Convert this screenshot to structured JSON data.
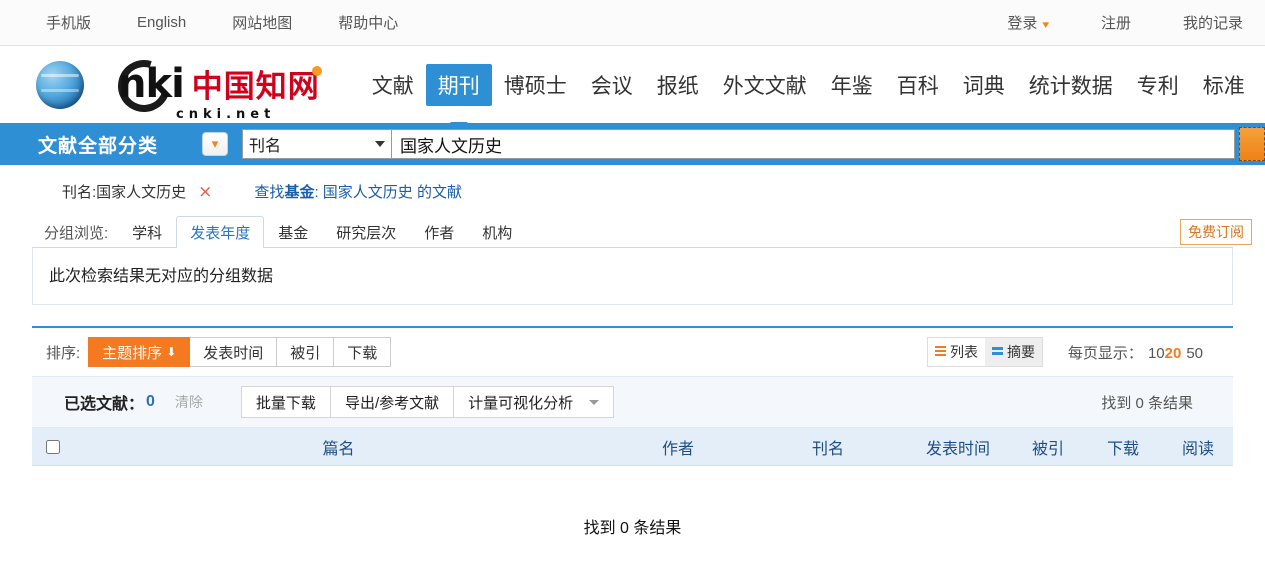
{
  "topbar": {
    "left_links": [
      "手机版",
      "English",
      "网站地图",
      "帮助中心"
    ],
    "login": "登录",
    "register": "注册",
    "my_records": "我的记录"
  },
  "logo": {
    "letters": "nki",
    "chinese": "中国知网",
    "url": "cnki.net"
  },
  "nav": {
    "items": [
      {
        "label": "文献",
        "active": false
      },
      {
        "label": "期刊",
        "active": true
      },
      {
        "label": "博硕士",
        "active": false
      },
      {
        "label": "会议",
        "active": false
      },
      {
        "label": "报纸",
        "active": false
      },
      {
        "label": "外文文献",
        "active": false
      },
      {
        "label": "年鉴",
        "active": false
      },
      {
        "label": "百科",
        "active": false
      },
      {
        "label": "词典",
        "active": false
      },
      {
        "label": "统计数据",
        "active": false
      },
      {
        "label": "专利",
        "active": false
      },
      {
        "label": "标准",
        "active": false
      }
    ]
  },
  "search": {
    "category_label": "文献全部分类",
    "field_selected": "刊名",
    "query_value": "国家人文历史",
    "query_placeholder": ""
  },
  "crumbs": {
    "term": "刊名:国家人文历史",
    "remove": "×",
    "link_prefix": "查找",
    "link_bold": "基金",
    "link_suffix": ": 国家人文历史 的文献"
  },
  "groups": {
    "label": "分组浏览:",
    "tabs": [
      {
        "label": "学科",
        "active": false
      },
      {
        "label": "发表年度",
        "active": true
      },
      {
        "label": "基金",
        "active": false
      },
      {
        "label": "研究层次",
        "active": false
      },
      {
        "label": "作者",
        "active": false
      },
      {
        "label": "机构",
        "active": false
      }
    ],
    "subscribe_badge": "免费订阅",
    "empty_message": "此次检索结果无对应的分组数据"
  },
  "toolbar": {
    "sort_label": "排序:",
    "sort_buttons": [
      {
        "label": "主题排序",
        "active": true,
        "arrow": "⬇"
      },
      {
        "label": "发表时间",
        "active": false,
        "arrow": ""
      },
      {
        "label": "被引",
        "active": false,
        "arrow": ""
      },
      {
        "label": "下载",
        "active": false,
        "arrow": ""
      }
    ],
    "view_list": "列表",
    "view_abstract": "摘要",
    "per_page_label": "每页显示：",
    "per_page_options": [
      "10",
      "20",
      "50"
    ],
    "per_page_selected": "20"
  },
  "selection": {
    "selected_label": "已选文献：",
    "selected_count": "0",
    "clear": "清除",
    "actions": [
      "批量下载",
      "导出/参考文献",
      "计量可视化分析"
    ],
    "found_text": "找到 0 条结果"
  },
  "table": {
    "columns": [
      "篇名",
      "作者",
      "刊名",
      "发表时间",
      "被引",
      "下载",
      "阅读"
    ],
    "rows": []
  },
  "footer": {
    "no_results": "找到 0 条结果"
  },
  "colors": {
    "brand_blue": "#2f8fd4",
    "accent_orange": "#f47920",
    "link_blue": "#1a5fa8",
    "logo_red": "#d0021b"
  }
}
